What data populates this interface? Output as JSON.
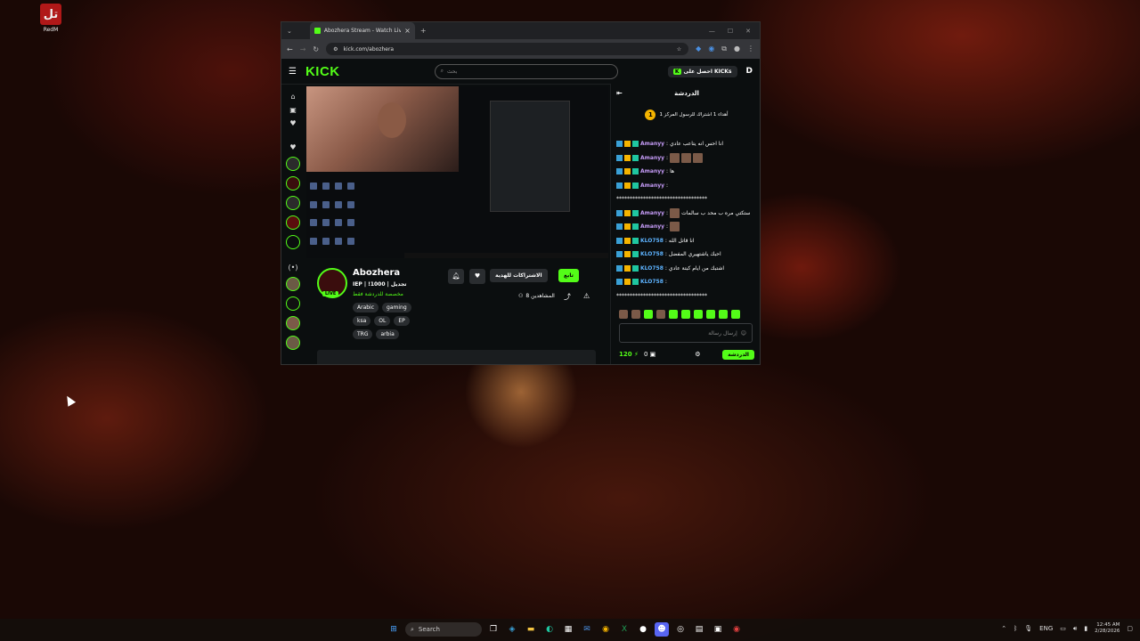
{
  "desktop": {
    "icon_label": "RedM",
    "icon_glyph": "تل"
  },
  "browser": {
    "tab_title": "Abozhera Stream - Watch Live",
    "new_tab": "+",
    "close_tab": "×",
    "url": "kick.com/abozhera"
  },
  "kick": {
    "logo": "KICK",
    "search_placeholder": "بحث",
    "get_kicks": "احصل على KICKs",
    "get_kicks_badge": "K"
  },
  "channel": {
    "name": "Abozhera",
    "title": "IEP | !1000 | تجديل",
    "category": "مخصصة للدردشة فقط",
    "live": "LIVE",
    "tags": [
      "Arabic",
      "gaming",
      "ksa",
      "OL",
      "EP",
      "TRG",
      "arbia"
    ],
    "follow_label": "تابع",
    "subscribe_label": "الاشتراكات للهدية",
    "viewers": "8 المشاهدين"
  },
  "chat": {
    "title": "الدردشة",
    "pinned": "أهداء 1 اشتراك للرسول المركز 1",
    "pinned_count": "1",
    "messages": [
      {
        "user": "Amanyy",
        "text": "انا احس انه يتاعب عادي",
        "style": "u1",
        "emotes": 0
      },
      {
        "user": "Amanyy",
        "text": "",
        "style": "u1",
        "emotes": 3
      },
      {
        "user": "Amanyy",
        "text": "ها",
        "style": "u1",
        "emotes": 0
      },
      {
        "user": "Amanyy",
        "text": "",
        "style": "u1",
        "emotes": 0
      },
      {
        "user": "",
        "text": "**********************************",
        "style": "",
        "emotes": 0
      },
      {
        "user": "Amanyy",
        "text": "ستكتي مره ب محد ب سالمات",
        "style": "u1",
        "emotes": 1
      },
      {
        "user": "Amanyy",
        "text": "",
        "style": "u1",
        "emotes": 1
      },
      {
        "user": "KLO758",
        "text": "انا قاتل الله",
        "style": "u2",
        "emotes": 0
      },
      {
        "user": "KLO758",
        "text": "احبك ياشتهيري المفضل",
        "style": "u2",
        "emotes": 0
      },
      {
        "user": "KLO758",
        "text": "اشتبك من ايام كبتة عادي",
        "style": "u2",
        "emotes": 0
      },
      {
        "user": "KLO758",
        "text": "",
        "style": "u2",
        "emotes": 0
      },
      {
        "user": "",
        "text": "**********************************",
        "style": "",
        "emotes": 0
      }
    ],
    "input_placeholder": "إرسال رسالة",
    "points": "120",
    "kicks": "0",
    "send_label": "الدردشة"
  },
  "taskbar": {
    "search_label": "Search",
    "lang": "ENG",
    "time": "12:45 AM",
    "date": "2/28/2026"
  }
}
